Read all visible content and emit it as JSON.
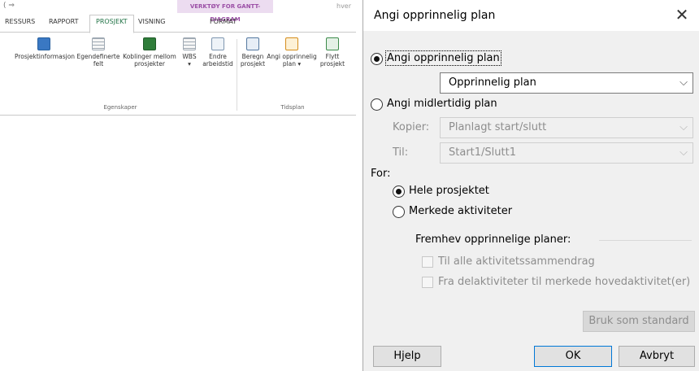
{
  "ribbon": {
    "qat": "( ⇒",
    "context_header": "VERKTØY FOR GANTT-DIAGRAM",
    "window_title": "hver",
    "tabs": {
      "ressurs": "RESSURS",
      "rapport": "RAPPORT",
      "prosjekt": "PROSJEKT",
      "visning": "VISNING",
      "format": "FORMAT"
    },
    "buttons": {
      "prosjektinformasjon": "Prosjektinformasjon",
      "egendefinerte_1": "Egendefinerte",
      "egendefinerte_2": "felt",
      "koblinger_1": "Koblinger mellom",
      "koblinger_2": "prosjekter",
      "wbs_1": "WBS",
      "wbs_2": "▾",
      "endre_1": "Endre",
      "endre_2": "arbeidstid",
      "beregn_1": "Beregn",
      "beregn_2": "prosjekt",
      "angi_1": "Angi opprinnelig",
      "angi_2": "plan ▾",
      "flytt_1": "Flytt",
      "flytt_2": "prosjekt"
    },
    "groups": {
      "egenskaper": "Egenskaper",
      "tidsplan": "Tidsplan"
    }
  },
  "dialog": {
    "title": "Angi opprinnelig plan",
    "close": "✕",
    "option_baseline": "Angi opprinnelig plan",
    "baseline_select": "Opprinnelig plan",
    "option_interim": "Angi midlertidig plan",
    "copy_label": "Kopier:",
    "copy_select": "Planlagt start/slutt",
    "to_label": "Til:",
    "to_select": "Start1/Slutt1",
    "for_label": "For:",
    "scope_entire": "Hele prosjektet",
    "scope_selected": "Merkede aktiviteter",
    "rollup_group": "Fremhev opprinnelige planer:",
    "rollup_summary": "Til alle aktivitetssammendrag",
    "rollup_subtasks": "Fra delaktiviteter til merkede hovedaktivitet(er)",
    "btn_default": "Bruk som standard",
    "btn_help": "Hjelp",
    "btn_ok": "OK",
    "btn_cancel": "Avbryt",
    "chevron": "⌵"
  }
}
